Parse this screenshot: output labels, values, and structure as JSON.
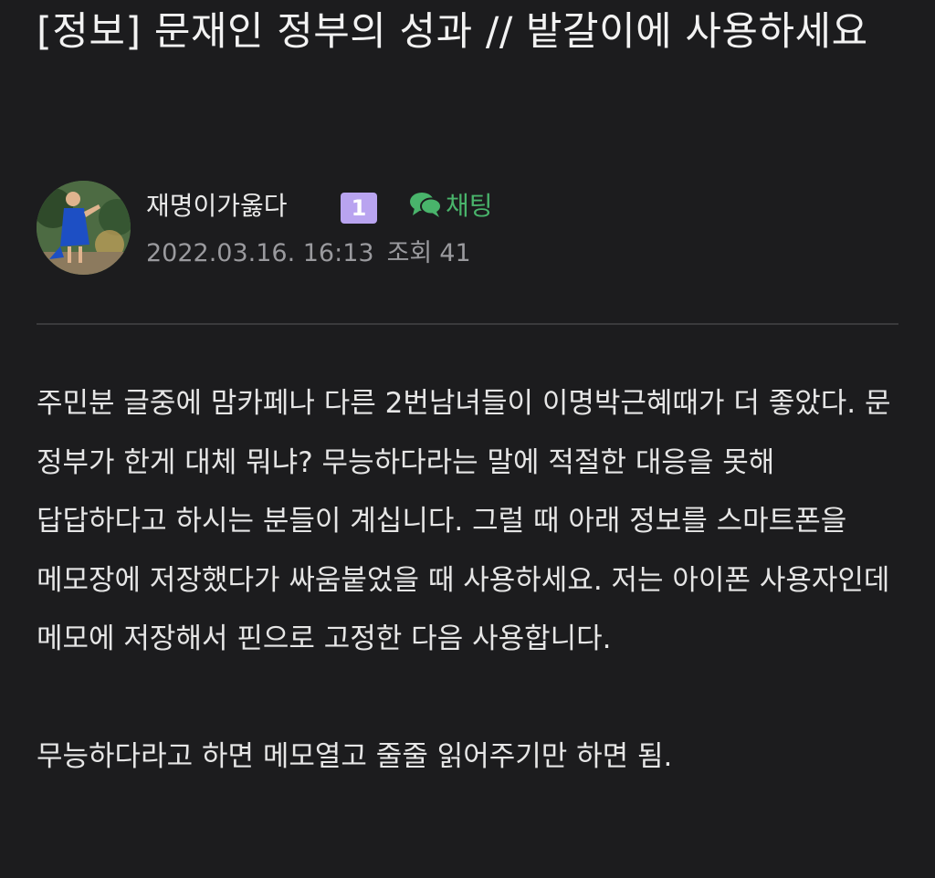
{
  "post": {
    "title": "[정보] 문재인 정부의 성과 // 밭갈이에 사용하세요",
    "author": {
      "name": "재명이가옳다",
      "level": "1",
      "avatar_icon": "profile-photo",
      "chat_label": "채팅",
      "chat_icon": "chat-bubbles-icon"
    },
    "meta": {
      "datetime": "2022.03.16. 16:13",
      "views_label": "조회",
      "views_count": "41"
    },
    "body": {
      "paragraph_1": "주민분 글중에 맘카페나 다른 2번남녀들이 이명박근혜때가 더 좋았다. 문 정부가 한게 대체 뭐냐? 무능하다라는 말에 적절한 대응을 못해 답답하다고 하시는 분들이 계십니다. 그럴 때 아래 정보를 스마트폰을 메모장에 저장했다가 싸움붙었을 때 사용하세요. 저는 아이폰 사용자인데 메모에 저장해서 핀으로 고정한 다음 사용합니다.",
      "paragraph_2": "무능하다라고 하면 메모열고 줄줄 읽어주기만 하면 됨."
    },
    "colors": {
      "background": "#1c1c1e",
      "chat_green": "#49b46b",
      "level_badge": "#b9a4f0",
      "meta_gray": "#9a9a9e"
    }
  }
}
